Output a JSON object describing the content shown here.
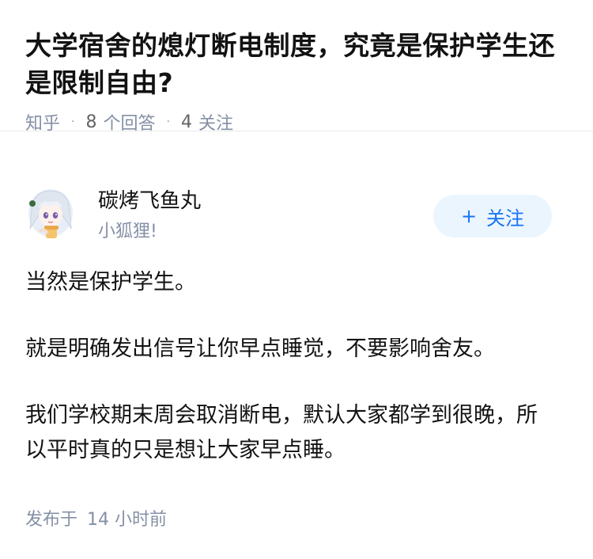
{
  "question": {
    "title": "大学宿舍的熄灯断电制度，究竟是保护学生还是限制自由?",
    "source": "知乎",
    "answer_count": "8",
    "answer_label": "个回答",
    "follower_count": "4",
    "follower_label": "关注"
  },
  "author": {
    "name": "碳烤飞鱼丸",
    "bio": "小狐狸!",
    "follow_plus": "+",
    "follow_label": "关注"
  },
  "answer": {
    "paragraphs": [
      "当然是保护学生。",
      "就是明确发出信号让你早点睡觉，不要影响舍友。",
      "我们学校期末周会取消断电，默认大家都学到很晚，所以平时真的只是想让大家早点睡。"
    ]
  },
  "footer": {
    "published_label": "发布于",
    "published_time": "14 小时前"
  },
  "colors": {
    "meta_gray": "#8590a6",
    "brand_blue": "#1772f6",
    "follow_bg": "#ebf5fd"
  }
}
